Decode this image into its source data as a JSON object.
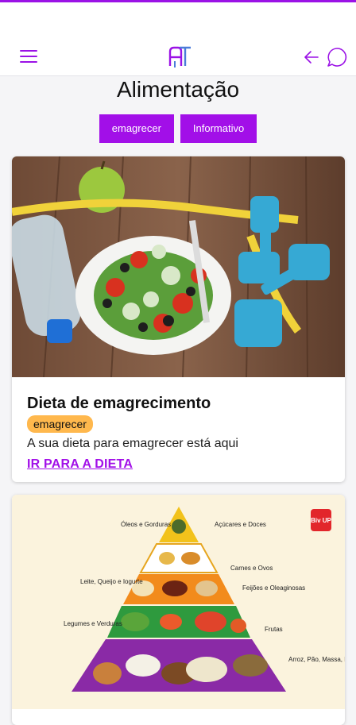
{
  "header": {
    "menu_icon": "menu-icon",
    "logo_icon": "app-logo",
    "back_icon": "arrow-left-icon",
    "chat_icon": "chat-bubble-icon",
    "accent_color": "#9b12e6"
  },
  "page": {
    "title": "Alimentação"
  },
  "filters": [
    {
      "label": "emagrecer"
    },
    {
      "label": "Informativo"
    }
  ],
  "cards": [
    {
      "image_description_icon": "salad-dumbbells-image",
      "title": "Dieta de emagrecimento",
      "badge": "emagrecer",
      "description": "A sua dieta para emagrecer está aqui",
      "link": "IR PARA A DIETA"
    },
    {
      "image_description_icon": "food-pyramid-image",
      "pyramid_labels": {
        "top_left": "Óleos e Gorduras",
        "top_right": "Açúcares e Doces",
        "carnes": "Carnes e Ovos",
        "leite": "Leite, Queijo e Iogurte",
        "feijoes": "Feijões e Oleaginosas",
        "legumes": "Legumes e Verduras",
        "frutas": "Frutas",
        "base": "Arroz, Pão, Massa, Batata, Mandioca",
        "brand": "Biv UP"
      }
    }
  ]
}
